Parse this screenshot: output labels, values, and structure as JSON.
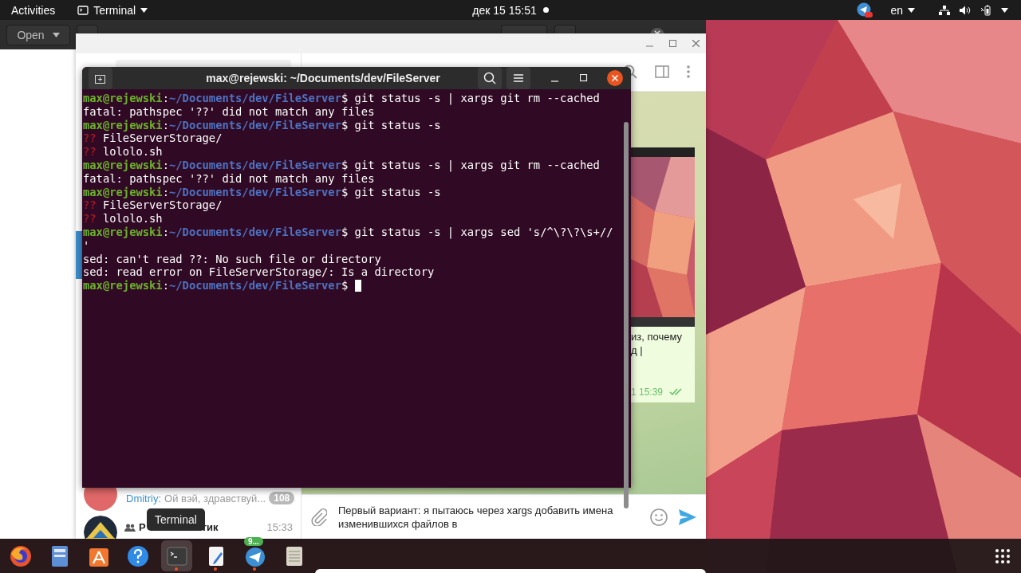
{
  "top_bar": {
    "activities": "Activities",
    "app_menu": "Terminal",
    "clock": "дек 15  15:51",
    "notification": true,
    "keyboard_layout": "en"
  },
  "text_editor": {
    "open_button": "Open"
  },
  "telegram": {
    "message": {
      "kind": "picture",
      "fragments": [
        "из, почему",
        "д |"
      ],
      "meta": "1 15:39",
      "read": true
    },
    "chats": [
      {
        "kind": "direct",
        "sender": "Dmitriy:",
        "preview": "Ой вэй, здравствуй...",
        "unread": "108"
      },
      {
        "kind": "group",
        "name_start": "Р",
        "name_end": "тик",
        "time": "15:33"
      }
    ],
    "draft": "Первый вариант: я пытаюсь через xargs добавить имена изменившихся файлов в"
  },
  "terminal": {
    "title": "max@rejewski: ~/Documents/dev/FileServer",
    "lines": [
      {
        "kind": "prompt",
        "user": "max@rejewski",
        "colon": ":",
        "path": "~/Documents/dev/FileServer",
        "dollar": "$",
        "command": "git status -s | xargs git rm --cached",
        "cursor": false
      },
      {
        "kind": "output",
        "text": "fatal: pathspec '??' did not match any files"
      },
      {
        "kind": "prompt",
        "user": "max@rejewski",
        "colon": ":",
        "path": "~/Documents/dev/FileServer",
        "dollar": "$",
        "command": "git status -s",
        "cursor": false
      },
      {
        "kind": "status",
        "code": "??",
        "text": "FileServerStorage/"
      },
      {
        "kind": "status",
        "code": "??",
        "text": "lololo.sh"
      },
      {
        "kind": "prompt",
        "user": "max@rejewski",
        "colon": ":",
        "path": "~/Documents/dev/FileServer",
        "dollar": "$",
        "command": "git status -s | xargs git rm --cached",
        "cursor": false
      },
      {
        "kind": "output",
        "text": "fatal: pathspec '??' did not match any files"
      },
      {
        "kind": "prompt",
        "user": "max@rejewski",
        "colon": ":",
        "path": "~/Documents/dev/FileServer",
        "dollar": "$",
        "command": "git status -s",
        "cursor": false
      },
      {
        "kind": "status",
        "code": "??",
        "text": "FileServerStorage/"
      },
      {
        "kind": "status",
        "code": "??",
        "text": "lololo.sh"
      },
      {
        "kind": "prompt",
        "user": "max@rejewski",
        "colon": ":",
        "path": "~/Documents/dev/FileServer",
        "dollar": "$",
        "command": "git status -s | xargs sed 's/^\\?\\?\\s+//",
        "cursor": false
      },
      {
        "kind": "output",
        "text": "'"
      },
      {
        "kind": "output",
        "text": "sed: can't read ??: No such file or directory"
      },
      {
        "kind": "output",
        "text": "sed: read error on FileServerStorage/: Is a directory"
      },
      {
        "kind": "prompt",
        "user": "max@rejewski",
        "colon": ":",
        "path": "~/Documents/dev/FileServer",
        "dollar": "$",
        "cursor": true
      }
    ]
  },
  "tooltip": "Terminal",
  "dock": {
    "apps": [
      {
        "kind": "browser",
        "running": false,
        "selected": false
      },
      {
        "kind": "files",
        "running": false,
        "selected": false
      },
      {
        "kind": "software",
        "running": false,
        "selected": false
      },
      {
        "kind": "help",
        "running": false,
        "selected": false
      },
      {
        "kind": "terminal",
        "running": true,
        "selected": true
      },
      {
        "kind": "editor",
        "running": true,
        "selected": false
      },
      {
        "kind": "messenger",
        "running": true,
        "selected": false,
        "badge": "9..."
      },
      {
        "kind": "notes",
        "running": false,
        "selected": false
      }
    ]
  }
}
